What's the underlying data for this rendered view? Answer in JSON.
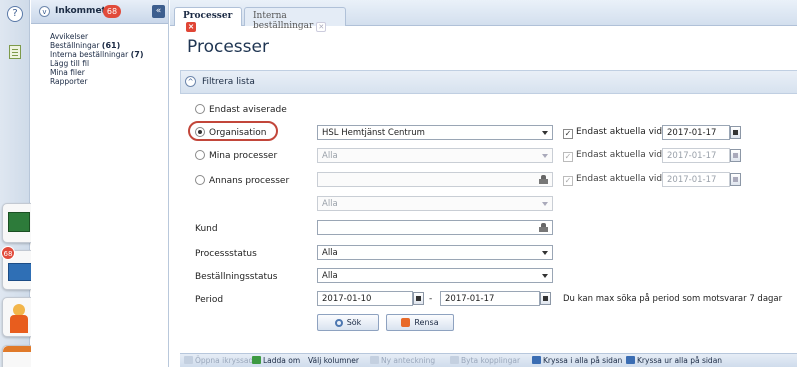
{
  "iconbar": {
    "help_label": "?",
    "tile_badge": "68"
  },
  "sidebar": {
    "inbox_title": "Inkommet",
    "inbox_badge": "68",
    "collapse_glyph": "«",
    "items": [
      {
        "label": "Avvikelser",
        "count": ""
      },
      {
        "label": "Beställningar",
        "count": "(61)"
      },
      {
        "label": "Interna beställningar",
        "count": "(7)"
      },
      {
        "label": "Lägg till fil",
        "count": ""
      },
      {
        "label": "Mina filer",
        "count": ""
      },
      {
        "label": "Rapporter",
        "count": ""
      }
    ]
  },
  "tabs": [
    {
      "label": "Processer",
      "active": true
    },
    {
      "label": "Interna beställningar",
      "active": false
    }
  ],
  "page": {
    "title": "Processer",
    "filter_title": "Filtrera lista"
  },
  "filter": {
    "radio_only_notified": "Endast aviserade",
    "radio_organisation": "Organisation",
    "radio_my_processes": "Mina processer",
    "radio_others_processes": "Annans processer",
    "organisation_value": "HSL Hemtjänst Centrum",
    "my_processes_value": "Alla",
    "others_processes_value": "",
    "others_sub_value": "Alla",
    "only_current_label": "Endast aktuella vid",
    "date_org": "2017-01-17",
    "date_my": "2017-01-17",
    "date_others": "2017-01-17",
    "customer_label": "Kund",
    "customer_value": "",
    "process_status_label": "Processstatus",
    "process_status_value": "Alla",
    "order_status_label": "Beställningsstatus",
    "order_status_value": "Alla",
    "period_label": "Period",
    "period_from": "2017-01-10",
    "period_separator": "-",
    "period_to": "2017-01-17",
    "period_hint": "Du kan max söka på period som motsvarar 7 dagar",
    "search_button": "Sök",
    "clear_button": "Rensa"
  },
  "bottombar": {
    "open_marked": "Öppna ikryssad",
    "reload": "Ladda om",
    "choose_columns": "Välj kolumner",
    "new_note": "Ny anteckning",
    "change_links": "Byta kopplingar",
    "check_all": "Kryssa i alla på sidan",
    "uncheck_all": "Kryssa ur alla på sidan"
  },
  "colors": {
    "accent": "#1f3552",
    "badge": "#e14b3b",
    "highlight_ring": "#c2463a"
  }
}
